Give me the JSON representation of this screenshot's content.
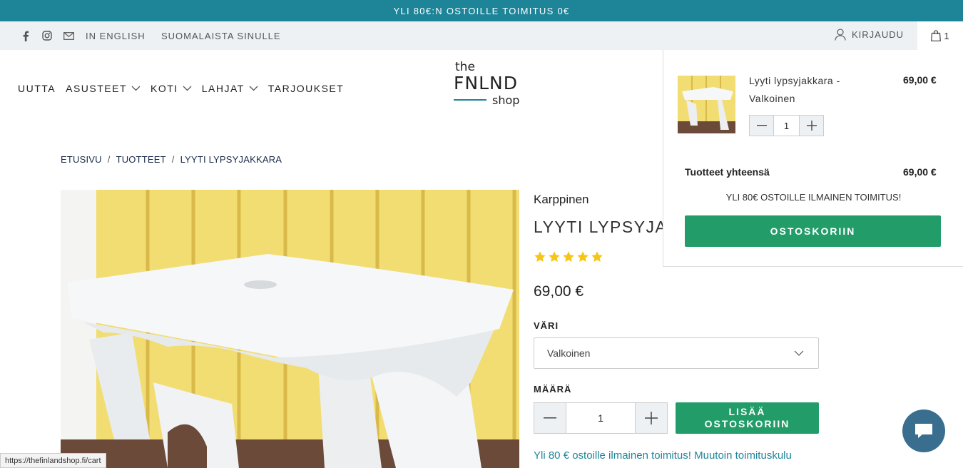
{
  "announcement": "YLI 80€:N OSTOILLE TOIMITUS 0€",
  "topbar": {
    "social_icons": [
      "facebook-icon",
      "instagram-icon",
      "mail-icon"
    ],
    "links": [
      "IN ENGLISH",
      "SUOMALAISTA SINULLE"
    ],
    "login_label": "KIRJAUDU",
    "cart_count": "1"
  },
  "nav": {
    "items": [
      {
        "label": "UUTTA",
        "has_dropdown": false
      },
      {
        "label": "ASUSTEET",
        "has_dropdown": true
      },
      {
        "label": "KOTI",
        "has_dropdown": true
      },
      {
        "label": "LAHJAT",
        "has_dropdown": true
      },
      {
        "label": "TARJOUKSET",
        "has_dropdown": false
      }
    ]
  },
  "logo": {
    "the": "the",
    "main": "FNLND",
    "shop": "shop"
  },
  "breadcrumb": [
    "ETUSIVU",
    "TUOTTEET",
    "LYYTI LYPSYJAKKARA"
  ],
  "product": {
    "vendor": "Karppinen",
    "title": "LYYTI LYPSYJAKKARA",
    "rating": 5,
    "rating_max": 5,
    "price": "69,00 €",
    "color_label": "VÄRI",
    "color_value": "Valkoinen",
    "qty_label": "MÄÄRÄ",
    "qty": "1",
    "add_line1": "LISÄÄ",
    "add_line2": "OSTOSKORIIN",
    "shipping_note": "Yli 80 € ostoille ilmainen toimitus! Muutoin toimituskulu"
  },
  "cart_drawer": {
    "item_name": "Lyyti lypsyjakkara - Valkoinen",
    "item_price": "69,00 €",
    "item_qty": "1",
    "total_label": "Tuotteet yhteensä",
    "total_value": "69,00 €",
    "free_shipping": "YLI 80€ OSTOILLE ILMAINEN TOIMITUS!",
    "checkout_label": "OSTOSKORIIN"
  },
  "status_url": "https://thefinlandshop.fi/cart",
  "colors": {
    "teal": "#1e8599",
    "green": "#229c68",
    "star": "#f5c518",
    "chat": "#3a6e8e"
  }
}
